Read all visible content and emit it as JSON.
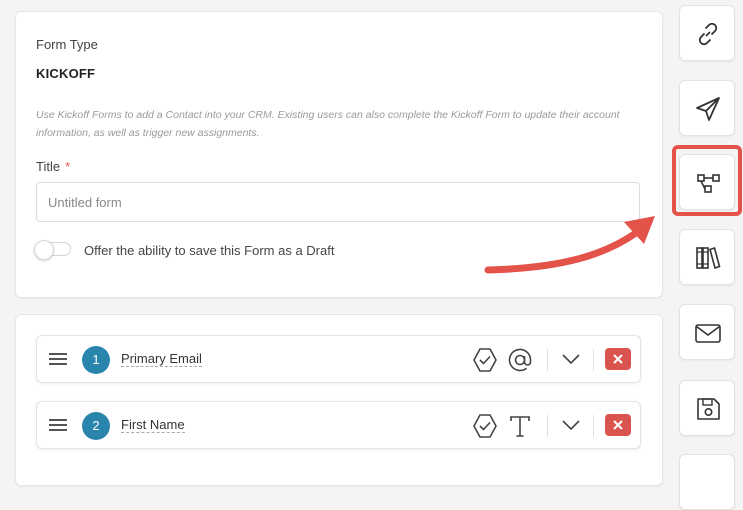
{
  "form": {
    "form_type_label": "Form Type",
    "form_type_value": "KICKOFF",
    "description": "Use Kickoff Forms to add a Contact into your CRM. Existing users can also complete the Kickoff Form to update their account information, as well as trigger new assignments.",
    "title_label": "Title",
    "required_mark": "*",
    "title_placeholder": "Untitled form",
    "title_value": "",
    "draft_toggle_label": "Offer the ability to save this Form as a Draft",
    "draft_toggle_on": false
  },
  "fields": [
    {
      "number": "1",
      "name": "Primary Email",
      "type_icon": "at-sign-icon"
    },
    {
      "number": "2",
      "name": "First Name",
      "type_icon": "text-type-icon"
    }
  ],
  "sidebar": {
    "buttons": [
      {
        "icon": "link-icon"
      },
      {
        "icon": "send-icon"
      },
      {
        "icon": "workflow-icon",
        "highlighted": true
      },
      {
        "icon": "library-icon"
      },
      {
        "icon": "mail-icon"
      },
      {
        "icon": "save-icon"
      }
    ]
  },
  "colors": {
    "accent_blue": "#2a85ad",
    "delete_red": "#d9534f",
    "annotation_red": "#e4534a"
  }
}
